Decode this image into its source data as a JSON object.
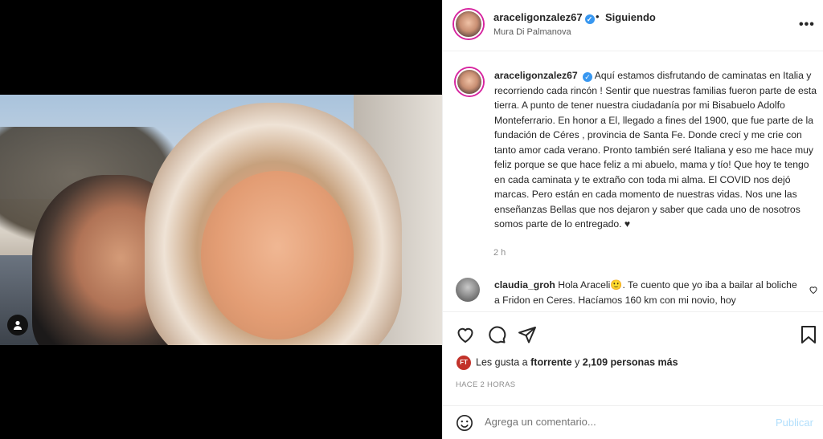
{
  "post": {
    "username": "araceligonzalez67",
    "follow_status": "Siguiendo",
    "dot": "•",
    "location": "Mura Di Palmanova",
    "more": "•••"
  },
  "caption": {
    "username": "araceligonzalez67",
    "text": "Aquí estamos disfrutando de caminatas en Italia y recorriendo cada rincón ! Sentir que nuestras familias fueron parte de esta tierra. A punto de tener nuestra ciudadanía por mi Bisabuelo Adolfo Monteferrario. En honor a El, llegado a fines del 1900, que fue parte de la fundación de Céres , provincia de Santa Fe. Donde crecí y me crie con tanto amor cada verano. Pronto también seré Italiana y eso me hace muy feliz porque se que hace feliz a mi abuelo, mama y tío! Que hoy te tengo en cada caminata y te extraño con toda mi alma. El COVID nos dejó marcas. Pero están en cada momento de nuestras vidas. Nos une las enseñanzas Bellas que nos dejaron y saber que cada uno de nosotros somos parte de lo entregado. ♥",
    "time": "2 h"
  },
  "comment": {
    "username": "claudia_groh",
    "text": "Hola Araceli🙂. Te cuento que yo iba a bailar al boliche a Fridon en Ceres. Hacíamos 160 km con mi novio, hoy"
  },
  "likes": {
    "badge": "FT",
    "prefix": "Les gusta a",
    "user": "ftorrente",
    "and": "y",
    "count": "2,109 personas más"
  },
  "timestamp": "HACE 2 HORAS",
  "add_comment": {
    "placeholder": "Agrega un comentario...",
    "publish": "Publicar"
  },
  "icons": [
    "user-tag-icon",
    "heart-icon",
    "comment-icon",
    "share-icon",
    "bookmark-icon",
    "emoji-icon",
    "verified-icon",
    "more-options-icon"
  ],
  "colors": {
    "verified": "#3897f0",
    "publish_disabled": "#b2dffc",
    "badge": "#c2322a"
  }
}
